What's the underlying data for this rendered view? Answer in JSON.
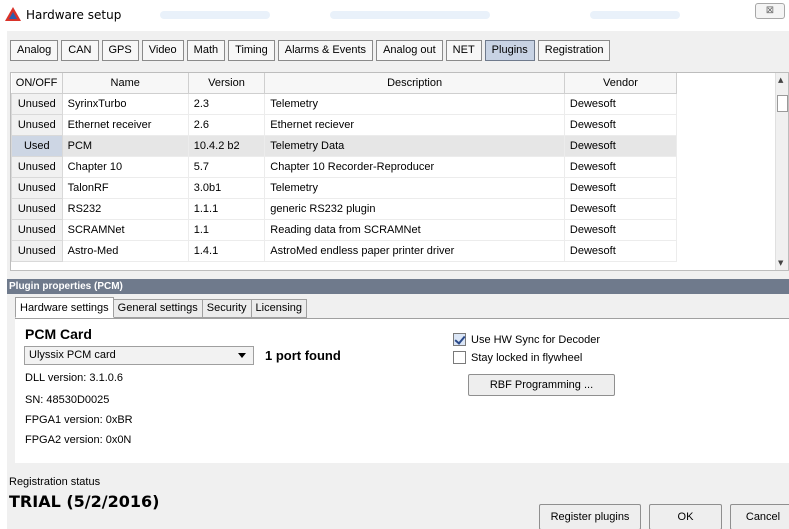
{
  "window": {
    "title": "Hardware setup",
    "close_glyph": "⊠"
  },
  "tabs": [
    {
      "label": "Analog",
      "active": false
    },
    {
      "label": "CAN",
      "active": false
    },
    {
      "label": "GPS",
      "active": false
    },
    {
      "label": "Video",
      "active": false
    },
    {
      "label": "Math",
      "active": false
    },
    {
      "label": "Timing",
      "active": false
    },
    {
      "label": "Alarms & Events",
      "active": false
    },
    {
      "label": "Analog out",
      "active": false
    },
    {
      "label": "NET",
      "active": false
    },
    {
      "label": "Plugins",
      "active": true
    },
    {
      "label": "Registration",
      "active": false
    }
  ],
  "plugins_table": {
    "columns": [
      "ON/OFF",
      "Name",
      "Version",
      "Description",
      "Vendor"
    ],
    "rows": [
      {
        "state": "Unused",
        "name": "SyrinxTurbo",
        "version": "2.3",
        "description": "Telemetry",
        "vendor": "Dewesoft"
      },
      {
        "state": "Unused",
        "name": "Ethernet receiver",
        "version": "2.6",
        "description": "Ethernet reciever",
        "vendor": "Dewesoft"
      },
      {
        "state": "Used",
        "name": "PCM",
        "version": "10.4.2 b2",
        "description": "Telemetry Data",
        "vendor": "Dewesoft"
      },
      {
        "state": "Unused",
        "name": "Chapter 10",
        "version": "5.7",
        "description": "Chapter 10 Recorder-Reproducer",
        "vendor": "Dewesoft"
      },
      {
        "state": "Unused",
        "name": "TalonRF",
        "version": "3.0b1",
        "description": "Telemetry",
        "vendor": "Dewesoft"
      },
      {
        "state": "Unused",
        "name": "RS232",
        "version": "1.1.1",
        "description": "generic RS232 plugin",
        "vendor": "Dewesoft"
      },
      {
        "state": "Unused",
        "name": "SCRAMNet",
        "version": "1.1",
        "description": "Reading data from SCRAMNet",
        "vendor": "Dewesoft"
      },
      {
        "state": "Unused",
        "name": "Astro-Med",
        "version": "1.4.1",
        "description": "AstroMed endless paper printer driver",
        "vendor": "Dewesoft"
      }
    ]
  },
  "properties": {
    "header": "Plugin properties (PCM)",
    "subtabs": [
      {
        "label": "Hardware settings",
        "active": true
      },
      {
        "label": "General settings",
        "active": false
      },
      {
        "label": "Security",
        "active": false
      },
      {
        "label": "Licensing",
        "active": false
      }
    ],
    "card_title": "PCM Card",
    "card_select_value": "Ulyssix PCM card",
    "port_found": "1 port found",
    "dll_version": "DLL version:  3.1.0.6",
    "sn": "SN: 48530D0025",
    "fpga1": "FPGA1 version: 0xBR",
    "fpga2": "FPGA2 version: 0x0N",
    "hw_sync_label": "Use HW Sync for Decoder",
    "hw_sync_checked": true,
    "stay_locked_label": "Stay locked in flywheel",
    "stay_locked_checked": false,
    "rbf_button": "RBF Programming ..."
  },
  "registration": {
    "label": "Registration status",
    "status": "TRIAL (5/2/2016)"
  },
  "footer": {
    "register_plugins": "Register plugins",
    "ok": "OK",
    "cancel": "Cancel"
  }
}
